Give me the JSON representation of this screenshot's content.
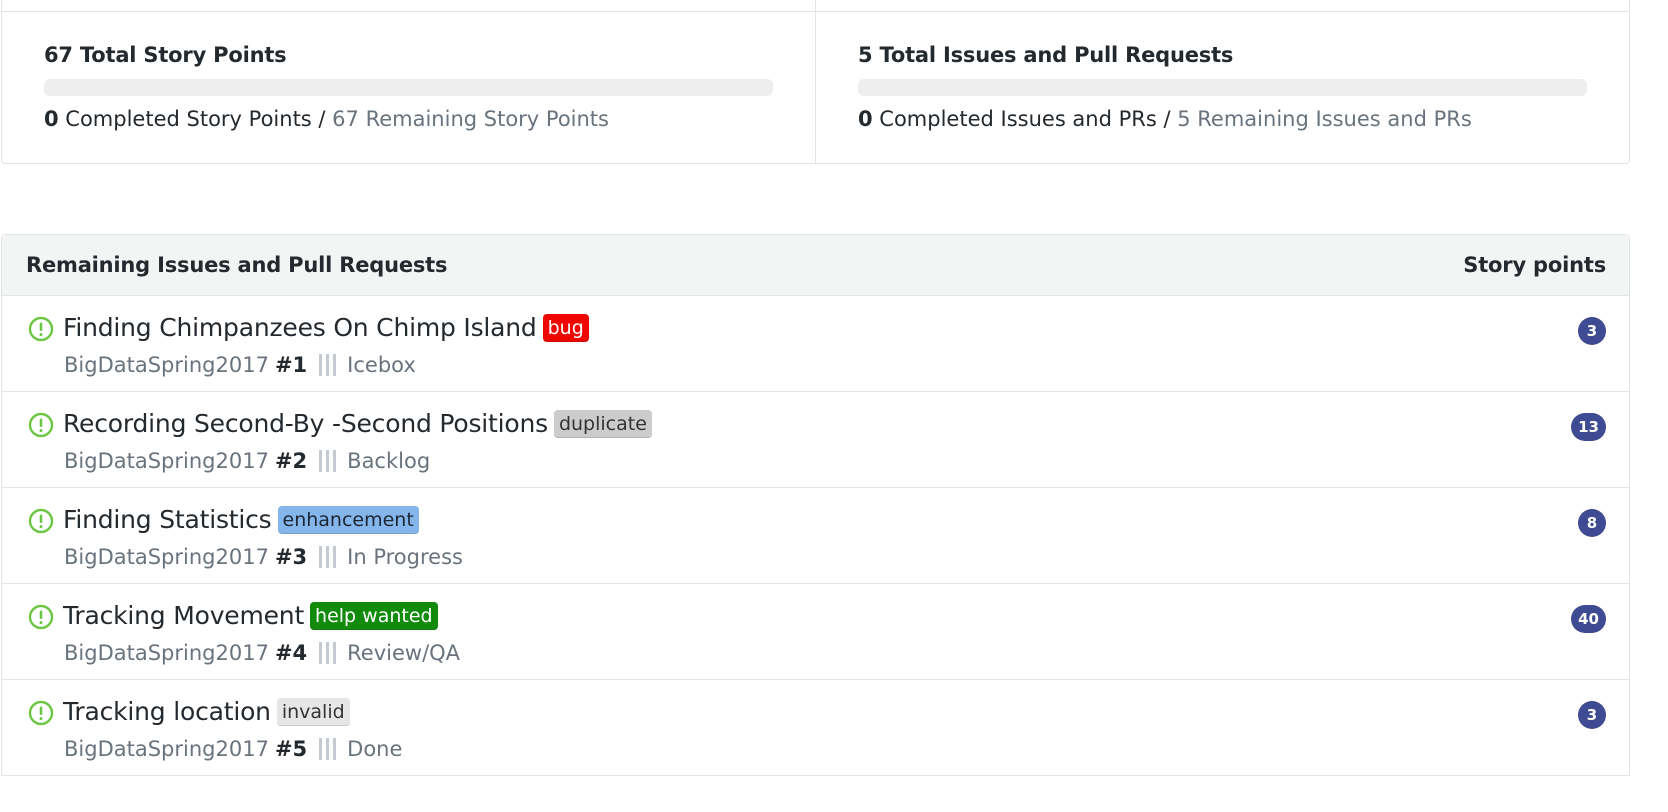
{
  "summary": {
    "story_points": {
      "title": "67 Total Story Points",
      "completed_value": "0",
      "completed_label": " Completed Story Points / ",
      "remaining_label": "67 Remaining Story Points",
      "progress_fraction": 0
    },
    "issues": {
      "title": "5 Total Issues and Pull Requests",
      "completed_value": "0",
      "completed_label": " Completed Issues and PRs / ",
      "remaining_label": "5 Remaining Issues and PRs",
      "progress_fraction": 0
    }
  },
  "issues_table": {
    "header_title": "Remaining Issues and Pull Requests",
    "header_points": "Story points",
    "rows": [
      {
        "title": "Finding Chimpanzees On Chimp Island",
        "label": "bug",
        "label_bg": "#ee0701",
        "label_fg": "#ffffff",
        "repo": "BigDataSpring2017",
        "number": "#1",
        "pipeline": "Icebox",
        "points": "3",
        "icon": "issue-opened-icon"
      },
      {
        "title": "Recording Second-By -Second Positions",
        "label": "duplicate",
        "label_bg": "#cccccc",
        "label_fg": "#333333",
        "repo": "BigDataSpring2017",
        "number": "#2",
        "pipeline": "Backlog",
        "points": "13",
        "icon": "issue-opened-icon"
      },
      {
        "title": "Finding Statistics",
        "label": "enhancement",
        "label_bg": "#84b6eb",
        "label_fg": "#1c2733",
        "repo": "BigDataSpring2017",
        "number": "#3",
        "pipeline": "In Progress",
        "points": "8",
        "icon": "issue-opened-icon"
      },
      {
        "title": "Tracking Movement",
        "label": "help wanted",
        "label_bg": "#128a0c",
        "label_fg": "#ffffff",
        "repo": "BigDataSpring2017",
        "number": "#4",
        "pipeline": "Review/QA",
        "points": "40",
        "icon": "issue-opened-icon"
      },
      {
        "title": "Tracking location",
        "label": "invalid",
        "label_bg": "#e6e6e6",
        "label_fg": "#333333",
        "repo": "BigDataSpring2017",
        "number": "#5",
        "pipeline": "Done",
        "points": "3",
        "icon": "issue-opened-icon"
      }
    ]
  },
  "colors": {
    "issue_open_icon": "#6cc644",
    "points_badge": "#3e4a91"
  }
}
